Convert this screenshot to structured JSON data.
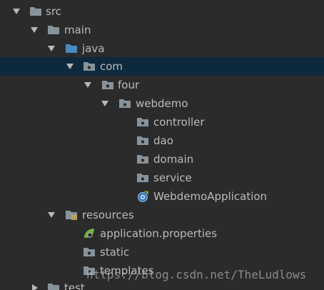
{
  "project_tree": {
    "nodes": [
      {
        "label": "src",
        "icon": "folder-icon",
        "expanded": true
      },
      {
        "label": "main",
        "icon": "folder-icon",
        "expanded": true
      },
      {
        "label": "java",
        "icon": "source-folder-icon",
        "expanded": true
      },
      {
        "label": "com",
        "icon": "package-icon",
        "expanded": true,
        "selected": true
      },
      {
        "label": "four",
        "icon": "package-icon",
        "expanded": true
      },
      {
        "label": "webdemo",
        "icon": "package-icon",
        "expanded": true
      },
      {
        "label": "controller",
        "icon": "package-icon"
      },
      {
        "label": "dao",
        "icon": "package-icon"
      },
      {
        "label": "domain",
        "icon": "package-icon"
      },
      {
        "label": "service",
        "icon": "package-icon"
      },
      {
        "label": "WebdemoApplication",
        "icon": "spring-boot-class-icon"
      },
      {
        "label": "resources",
        "icon": "resources-folder-icon",
        "expanded": true
      },
      {
        "label": "application.properties",
        "icon": "spring-properties-icon"
      },
      {
        "label": "static",
        "icon": "package-icon"
      },
      {
        "label": "templates",
        "icon": "package-icon"
      },
      {
        "label": "test",
        "icon": "folder-icon",
        "expanded": false
      }
    ]
  },
  "watermark": "https://blog.csdn.net/TheLudlows",
  "colors": {
    "background": "#2b2b2b",
    "selection": "#0d293e",
    "text": "#bbbbbb",
    "folder": "#87939a",
    "source_folder": "#4a8bbf",
    "spring_green": "#6db33f"
  }
}
